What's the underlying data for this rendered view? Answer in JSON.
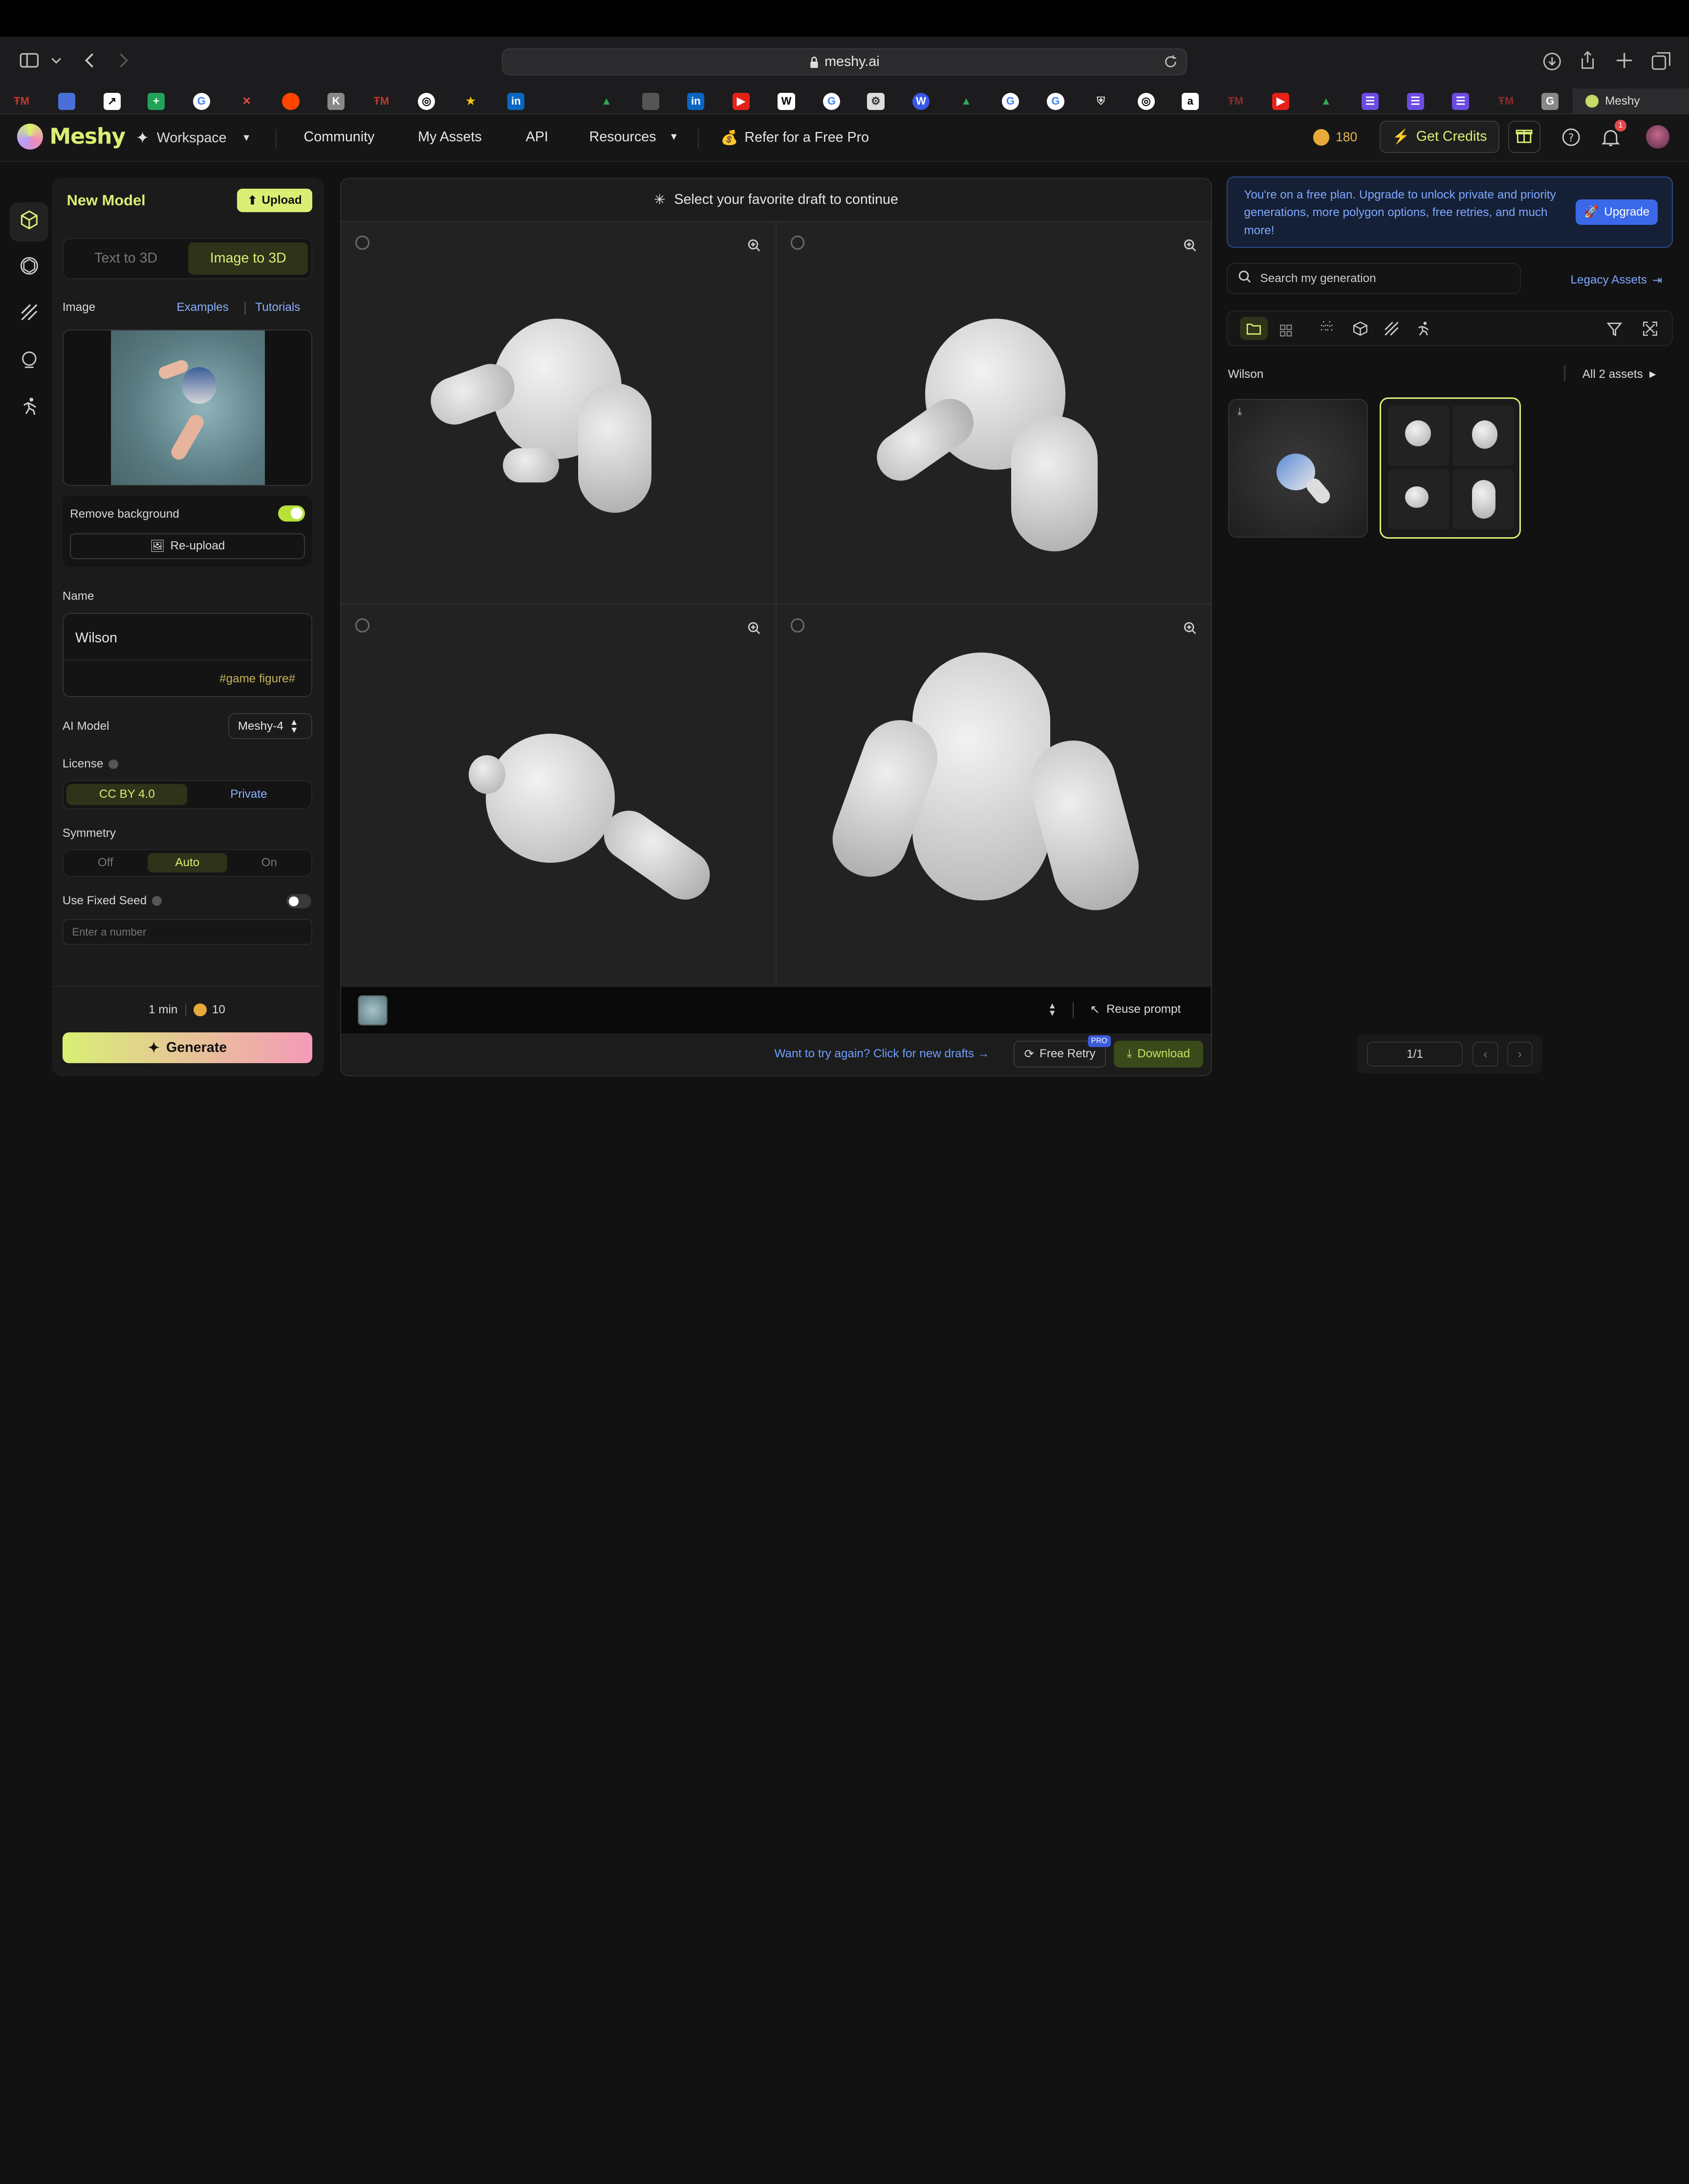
{
  "browser": {
    "url": "meshy.ai",
    "active_tab": "Meshy"
  },
  "nav": {
    "logo": "Meshy",
    "workspace": "Workspace",
    "community": "Community",
    "my_assets": "My Assets",
    "api": "API",
    "resources": "Resources",
    "refer": "Refer for a Free Pro",
    "credits": "180",
    "get_credits": "Get Credits",
    "notifications": "1"
  },
  "panel": {
    "title": "New Model",
    "upload": "Upload",
    "tabs": [
      "Text to 3D",
      "Image to 3D"
    ],
    "image_label": "Image",
    "examples": "Examples",
    "tutorials": "Tutorials",
    "remove_bg": "Remove background",
    "reupload": "Re-upload",
    "name_label": "Name",
    "name_value": "Wilson",
    "tag": "#game figure#",
    "ai_model_label": "AI Model",
    "ai_model_value": "Meshy-4",
    "license_label": "License",
    "license_options": [
      "CC BY 4.0",
      "Private"
    ],
    "symmetry_label": "Symmetry",
    "symmetry_options": [
      "Off",
      "Auto",
      "On"
    ],
    "fixed_seed_label": "Use Fixed Seed",
    "seed_placeholder": "Enter a number",
    "time": "1 min",
    "cost": "10",
    "generate": "Generate"
  },
  "main": {
    "header": "Select your favorite draft to continue",
    "reuse_prompt": "Reuse prompt",
    "try_again": "Want to try again? Click for new drafts →",
    "free_retry": "Free Retry",
    "pro_badge": "PRO",
    "download": "Download"
  },
  "right": {
    "banner": "You're on a free plan. Upgrade to unlock private and priority generations, more polygon options, free retries, and much more!",
    "upgrade": "Upgrade",
    "search_placeholder": "Search my generation",
    "legacy": "Legacy Assets",
    "group_name": "Wilson",
    "all_assets": "All 2 assets",
    "page": "1/1"
  }
}
